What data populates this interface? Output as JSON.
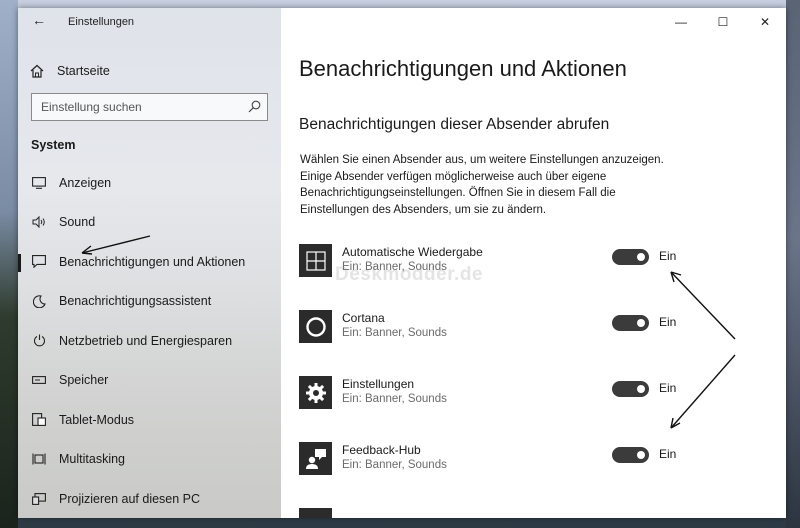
{
  "app": {
    "title": "Einstellungen",
    "back_icon": "back-arrow-icon"
  },
  "sidebar": {
    "home_label": "Startseite",
    "search_placeholder": "Einstellung suchen",
    "section": "System",
    "items": [
      {
        "label": "Anzeigen",
        "icon": "monitor-icon",
        "active": false
      },
      {
        "label": "Sound",
        "icon": "speaker-icon",
        "active": false
      },
      {
        "label": "Benachrichtigungen und Aktionen",
        "icon": "notification-icon",
        "active": true
      },
      {
        "label": "Benachrichtigungsassistent",
        "icon": "moon-icon",
        "active": false
      },
      {
        "label": "Netzbetrieb und Energiesparen",
        "icon": "power-icon",
        "active": false
      },
      {
        "label": "Speicher",
        "icon": "storage-icon",
        "active": false
      },
      {
        "label": "Tablet-Modus",
        "icon": "tablet-icon",
        "active": false
      },
      {
        "label": "Multitasking",
        "icon": "multitasking-icon",
        "active": false
      },
      {
        "label": "Projizieren auf diesen PC",
        "icon": "projector-icon",
        "active": false
      }
    ]
  },
  "window_controls": {
    "minimize": "—",
    "maximize": "☐",
    "close": "✕"
  },
  "main": {
    "title": "Benachrichtigungen und Aktionen",
    "subtitle": "Benachrichtigungen dieser Absender abrufen",
    "description": "Wählen Sie einen Absender aus, um weitere Einstellungen anzuzeigen. Einige Absender verfügen möglicherweise auch über eigene Benachrichtigungseinstellungen. Öffnen Sie in diesem Fall die Einstellungen des Absenders, um sie zu ändern.",
    "watermark": "Deskmodder.de",
    "senders": [
      {
        "name": "Automatische Wiedergabe",
        "sub": "Ein: Banner, Sounds",
        "toggle": "Ein",
        "on": true,
        "icon": "autoplay-icon"
      },
      {
        "name": "Cortana",
        "sub": "Ein: Banner, Sounds",
        "toggle": "Ein",
        "on": true,
        "icon": "cortana-icon"
      },
      {
        "name": "Einstellungen",
        "sub": "Ein: Banner, Sounds",
        "toggle": "Ein",
        "on": true,
        "icon": "gear-icon"
      },
      {
        "name": "Feedback-Hub",
        "sub": "Ein: Banner, Sounds",
        "toggle": "Ein",
        "on": true,
        "icon": "feedback-hub-icon"
      }
    ]
  },
  "colors": {
    "toggle_on": "#3b3b3b",
    "icon_tile": "#2b2b2b",
    "secondary_text": "#6b6b6b"
  }
}
